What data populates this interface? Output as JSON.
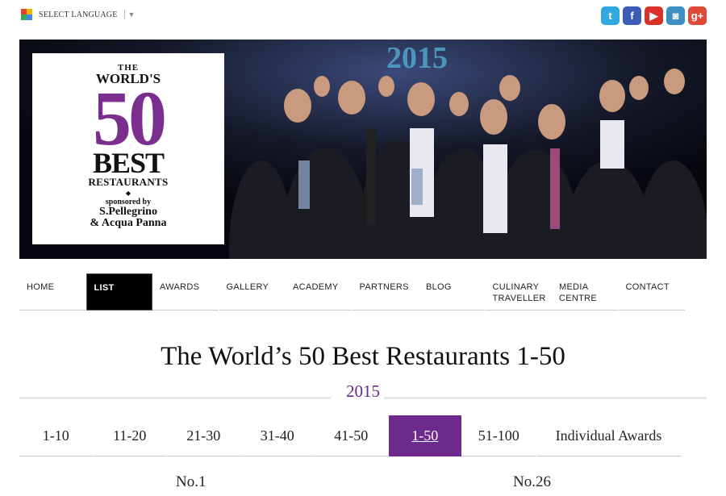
{
  "language": {
    "label": "SELECT LANGUAGE",
    "arrow": "▼"
  },
  "social": [
    {
      "name": "twitter",
      "glyph": "t",
      "color": "#2fa9e0"
    },
    {
      "name": "facebook",
      "glyph": "f",
      "color": "#3b5bb5"
    },
    {
      "name": "youtube",
      "glyph": "▶",
      "color": "#d9322a"
    },
    {
      "name": "instagram",
      "glyph": "◙",
      "color": "#3d8fc4"
    },
    {
      "name": "google-plus",
      "glyph": "g+",
      "color": "#de4a37"
    }
  ],
  "hero": {
    "logo": {
      "the": "THE",
      "worlds": "WORLD'S",
      "fifty": "50",
      "best": "BEST",
      "restaurants": "RESTAURANTS",
      "sponsored": "sponsored by",
      "sponsor1": "S.Pellegrino",
      "sponsor2": "& Acqua Panna"
    },
    "backdrop_year": "2015"
  },
  "nav": {
    "home": "HOME",
    "list": "LIST",
    "awards": "AWARDS",
    "gallery": "GALLERY",
    "academy": "ACADEMY",
    "partners": "PARTNERS",
    "blog": "BLOG",
    "culinary_1": "CULINARY",
    "culinary_2": "TRAVELLER",
    "media_1": "MEDIA",
    "media_2": "CENTRE",
    "contact": "CONTACT"
  },
  "page": {
    "title": "The World’s 50 Best Restaurants 1-50",
    "year": "2015"
  },
  "tabs": {
    "t1": "1-10",
    "t2": "11-20",
    "t3": "21-30",
    "t4": "31-40",
    "t5": "41-50",
    "t6": "1-50",
    "t7": "51-100",
    "t8": "Individual Awards"
  },
  "ranks": {
    "left": "No.1",
    "right": "No.26"
  },
  "colors": {
    "accent": "#6e2a8c",
    "nav_active": "#000000"
  }
}
